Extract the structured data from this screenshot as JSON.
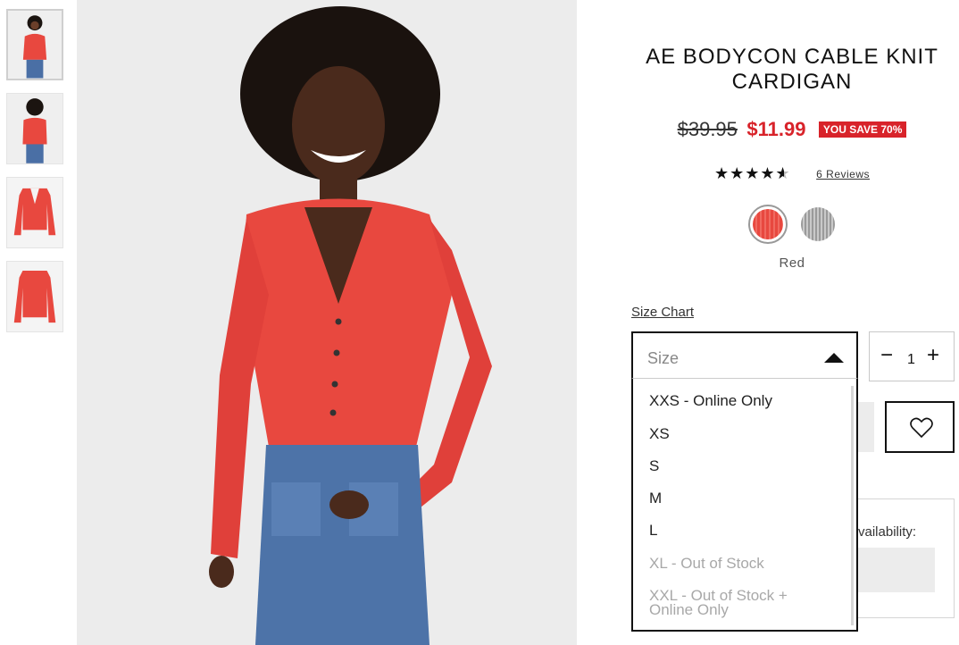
{
  "product": {
    "title_line1": "AE BODYCON CABLE KNIT",
    "title_line2": "CARDIGAN",
    "price_original": "$39.95",
    "price_sale": "$11.99",
    "savings_badge": "YOU SAVE 70%",
    "rating_value": 4.5,
    "rating_max": 5,
    "reviews_label": "6 Reviews",
    "selected_color": "Red",
    "colors": [
      "#e8483f",
      "#a8a8a8"
    ]
  },
  "size": {
    "chart_link": "Size Chart",
    "placeholder": "Size",
    "options": [
      {
        "label": "XXS - Online Only",
        "available": true
      },
      {
        "label": "XS",
        "available": true
      },
      {
        "label": "S",
        "available": true
      },
      {
        "label": "M",
        "available": true
      },
      {
        "label": "L",
        "available": true
      },
      {
        "label": "XL - Out of Stock",
        "available": false
      },
      {
        "label": "XXL - Out of Stock + Online Only",
        "available": false
      }
    ]
  },
  "quantity": {
    "minus": "−",
    "value": "1",
    "plus": "+"
  },
  "store": {
    "availability_partial": "vailability:"
  },
  "theme": {
    "sale_red": "#d8232a",
    "product_red": "#e8483f"
  }
}
